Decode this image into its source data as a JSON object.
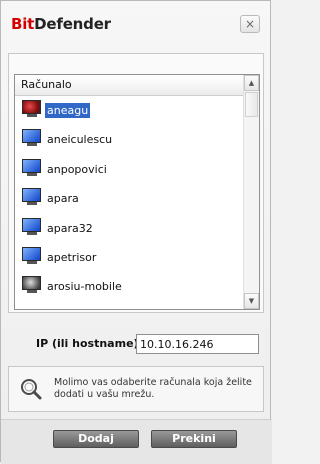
{
  "window": {
    "brand_part1": "Bit",
    "brand_part2": "Defender",
    "close_symbol": "×"
  },
  "list": {
    "column_header": "Računalo",
    "selected_index": 0,
    "items": [
      {
        "label": "aneagu",
        "icon": "computer-red-icon"
      },
      {
        "label": "aneiculescu",
        "icon": "computer-icon"
      },
      {
        "label": "anpopovici",
        "icon": "computer-icon"
      },
      {
        "label": "apara",
        "icon": "computer-icon"
      },
      {
        "label": "apara32",
        "icon": "computer-icon"
      },
      {
        "label": "apetrisor",
        "icon": "computer-icon"
      },
      {
        "label": "arosiu-mobile",
        "icon": "computer-grey-icon"
      }
    ],
    "scroll_up_symbol": "▲",
    "scroll_down_symbol": "▼"
  },
  "ip": {
    "label": "IP (ili hostname) :",
    "value": "10.10.16.246"
  },
  "info": {
    "icon": "search-icon",
    "text": "Molimo vas odaberite računala koja želite dodati u vašu mrežu."
  },
  "buttons": {
    "add": "Dodaj",
    "cancel": "Prekini"
  },
  "colors": {
    "brand_red": "#d40000",
    "selection_blue": "#3167c6"
  }
}
